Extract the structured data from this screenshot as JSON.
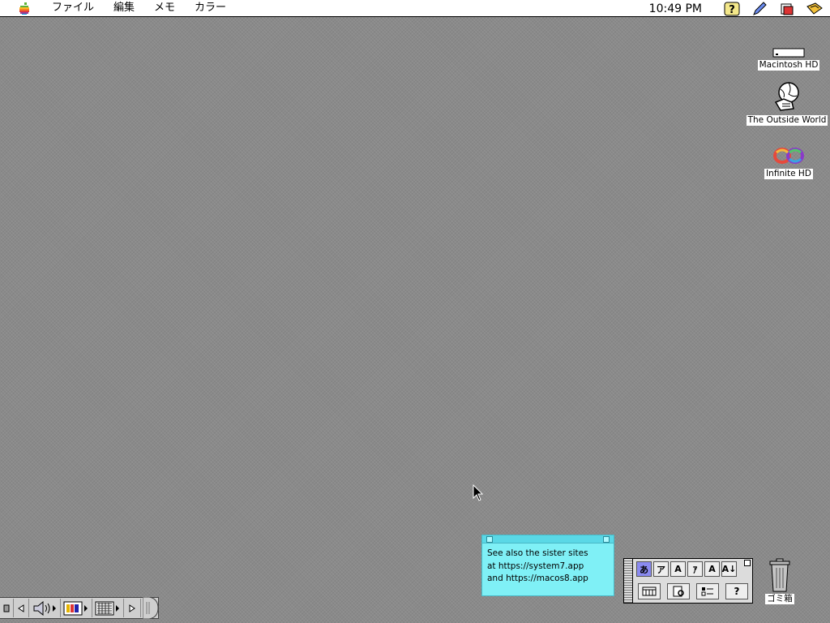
{
  "menubar": {
    "menus": [
      "ファイル",
      "編集",
      "メモ",
      "カラー"
    ],
    "clock": "10:49 PM",
    "extras": [
      "help-icon",
      "pencil-icon",
      "application-icon",
      "keyboard-icon"
    ]
  },
  "desktop": {
    "icons": [
      {
        "label": "Macintosh HD",
        "icon": "hard-drive-icon"
      },
      {
        "label": "The Outside World",
        "icon": "globe-hand-icon"
      },
      {
        "label": "Infinite HD",
        "icon": "infinity-icon"
      }
    ],
    "trash": {
      "label": "ゴミ箱",
      "icon": "trash-icon"
    }
  },
  "sticky": {
    "text": "See also the sister sites\nat https://system7.app\nand https://macos8.app",
    "color": "#7ff0f6"
  },
  "palette": {
    "row1": [
      "あ",
      "ア",
      "A",
      "ｱ",
      "A",
      "A↓"
    ],
    "row2": [
      "calendar-icon",
      "dictionary-icon",
      "tools-icon",
      "?"
    ]
  },
  "control_strip": {
    "modules": [
      "collapse-icon",
      "left-arrow-icon",
      "speaker-icon",
      "monitor-colors-icon",
      "resolution-icon",
      "right-arrow-icon"
    ]
  }
}
